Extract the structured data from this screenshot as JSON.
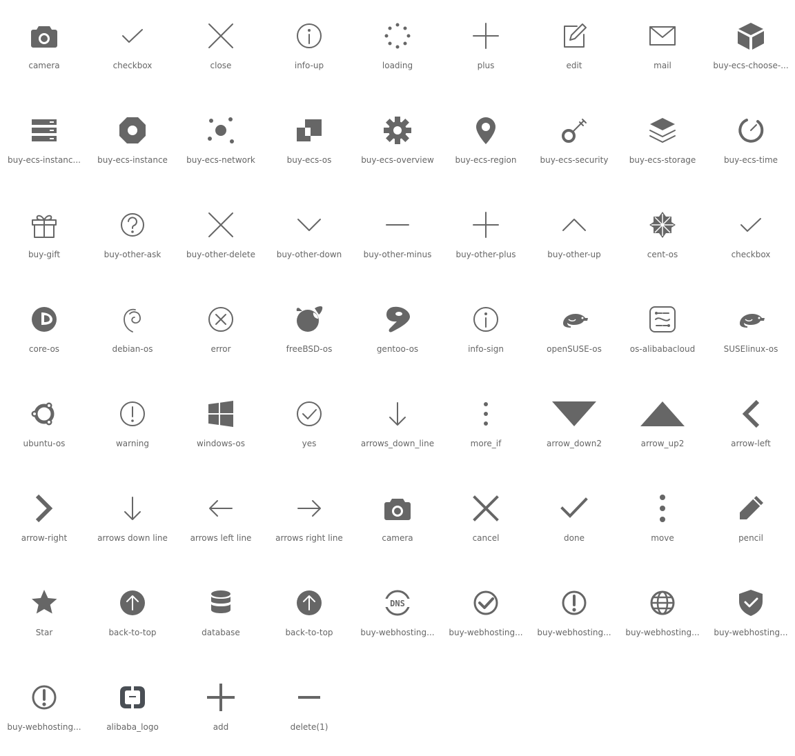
{
  "icons": [
    {
      "label": "camera",
      "icon": "camera-icon"
    },
    {
      "label": "checkbox",
      "icon": "check-icon"
    },
    {
      "label": "close",
      "icon": "close-icon"
    },
    {
      "label": "info-up",
      "icon": "info-circle-icon"
    },
    {
      "label": "loading",
      "icon": "loading-dots-icon"
    },
    {
      "label": "plus",
      "icon": "plus-icon"
    },
    {
      "label": "edit",
      "icon": "edit-icon"
    },
    {
      "label": "mail",
      "icon": "mail-icon"
    },
    {
      "label": "buy-ecs-choose-...",
      "icon": "cube-icon"
    },
    {
      "label": "buy-ecs-instanc...",
      "icon": "server-rack-icon"
    },
    {
      "label": "buy-ecs-instance",
      "icon": "octagon-ring-icon"
    },
    {
      "label": "buy-ecs-network",
      "icon": "network-nodes-icon"
    },
    {
      "label": "buy-ecs-os",
      "icon": "windows-stack-icon"
    },
    {
      "label": "buy-ecs-overview",
      "icon": "gear-icon"
    },
    {
      "label": "buy-ecs-region",
      "icon": "map-pin-icon"
    },
    {
      "label": "buy-ecs-security",
      "icon": "key-icon"
    },
    {
      "label": "buy-ecs-storage",
      "icon": "layers-icon"
    },
    {
      "label": "buy-ecs-time",
      "icon": "timer-icon"
    },
    {
      "label": "buy-gift",
      "icon": "gift-icon"
    },
    {
      "label": "buy-other-ask",
      "icon": "question-circle-icon"
    },
    {
      "label": "buy-other-delete",
      "icon": "close-icon"
    },
    {
      "label": "buy-other-down",
      "icon": "chevron-down-icon"
    },
    {
      "label": "buy-other-minus",
      "icon": "minus-icon"
    },
    {
      "label": "buy-other-plus",
      "icon": "plus-icon"
    },
    {
      "label": "buy-other-up",
      "icon": "chevron-up-icon"
    },
    {
      "label": "cent-os",
      "icon": "centos-logo-icon"
    },
    {
      "label": "checkbox",
      "icon": "check-icon"
    },
    {
      "label": "core-os",
      "icon": "coreos-logo-icon"
    },
    {
      "label": "debian-os",
      "icon": "debian-swirl-icon"
    },
    {
      "label": "error",
      "icon": "error-circle-icon"
    },
    {
      "label": "freeBSD-os",
      "icon": "freebsd-logo-icon"
    },
    {
      "label": "gentoo-os",
      "icon": "gentoo-logo-icon"
    },
    {
      "label": "info-sign",
      "icon": "info-circle-icon"
    },
    {
      "label": "openSUSE-os",
      "icon": "chameleon-icon"
    },
    {
      "label": "os-alibabacloud",
      "icon": "alibaba-os-icon"
    },
    {
      "label": "SUSElinux-os",
      "icon": "chameleon-icon"
    },
    {
      "label": "ubuntu-os",
      "icon": "ubuntu-logo-icon"
    },
    {
      "label": "warning",
      "icon": "warning-circle-icon"
    },
    {
      "label": "windows-os",
      "icon": "windows-logo-icon"
    },
    {
      "label": "yes",
      "icon": "check-circle-icon"
    },
    {
      "label": "arrows_down_line",
      "icon": "arrow-down-line-icon"
    },
    {
      "label": "more_if",
      "icon": "more-vertical-icon"
    },
    {
      "label": "arrow_down2",
      "icon": "triangle-down-icon"
    },
    {
      "label": "arrow_up2",
      "icon": "triangle-up-icon"
    },
    {
      "label": "arrow-left",
      "icon": "chevron-left-bold-icon"
    },
    {
      "label": "arrow-right",
      "icon": "chevron-right-bold-icon"
    },
    {
      "label": "arrows down line",
      "icon": "arrow-down-line-icon"
    },
    {
      "label": "arrows left line",
      "icon": "arrow-left-line-icon"
    },
    {
      "label": "arrows right line",
      "icon": "arrow-right-line-icon"
    },
    {
      "label": "camera",
      "icon": "camera-icon"
    },
    {
      "label": "cancel",
      "icon": "close-bold-icon"
    },
    {
      "label": "done",
      "icon": "check-bold-icon"
    },
    {
      "label": "move",
      "icon": "more-vertical-bold-icon"
    },
    {
      "label": "pencil",
      "icon": "pencil-icon"
    },
    {
      "label": "Star",
      "icon": "star-icon"
    },
    {
      "label": "back-to-top",
      "icon": "back-to-top-icon"
    },
    {
      "label": "database",
      "icon": "database-icon"
    },
    {
      "label": "back-to-top",
      "icon": "back-to-top-icon"
    },
    {
      "label": "buy-webhosting...",
      "icon": "dns-globe-icon"
    },
    {
      "label": "buy-webhosting...",
      "icon": "check-circle-bold-icon"
    },
    {
      "label": "buy-webhosting...",
      "icon": "warning-circle-bold-icon"
    },
    {
      "label": "buy-webhosting...",
      "icon": "globe-icon"
    },
    {
      "label": "buy-webhosting...",
      "icon": "shield-check-icon"
    },
    {
      "label": "buy-webhosting...",
      "icon": "warning-circle-bold-icon"
    },
    {
      "label": "alibaba_logo",
      "icon": "alibaba-logo-icon"
    },
    {
      "label": "add",
      "icon": "plus-bold-icon"
    },
    {
      "label": "delete(1)",
      "icon": "minus-bold-icon"
    }
  ],
  "colors": {
    "icon": "#666666",
    "label": "#666666",
    "background": "#ffffff"
  }
}
